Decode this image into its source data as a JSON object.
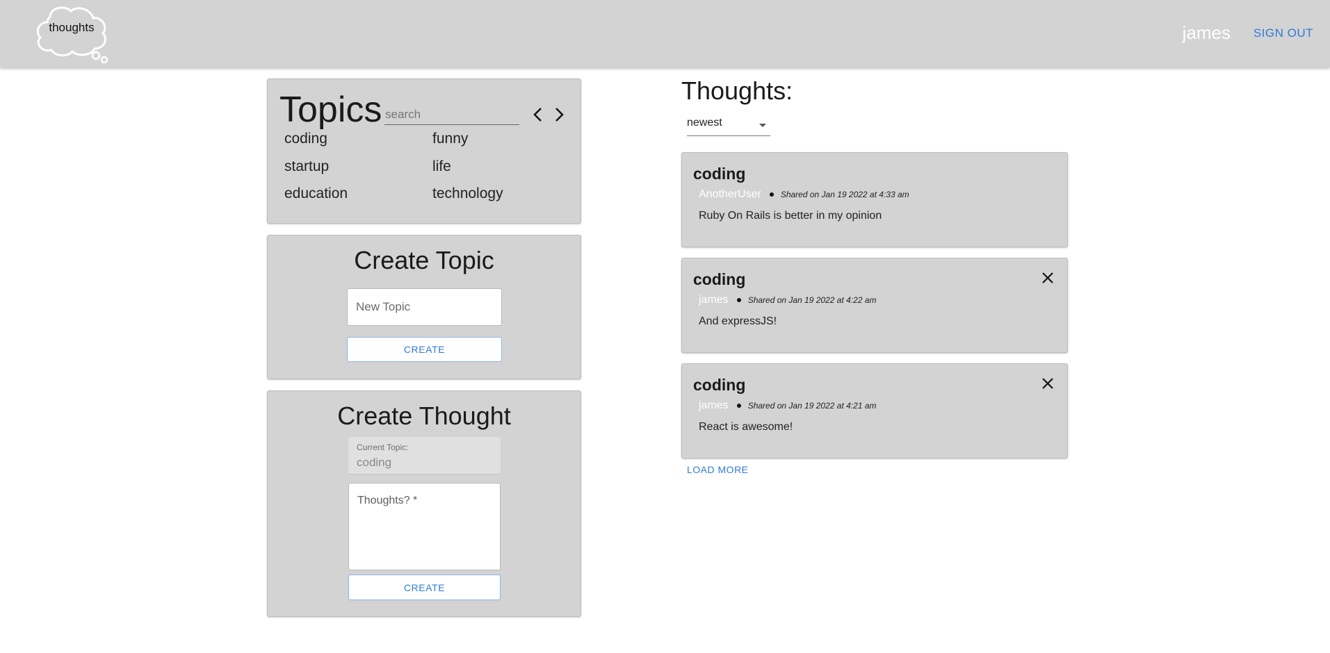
{
  "header": {
    "logo_text": "thoughts",
    "user_name": "james",
    "sign_out_label": "SIGN OUT",
    "accent_color": "#2f7bd6",
    "bar_color": "#d3d3d3"
  },
  "topics": {
    "title": "Topics",
    "search_placeholder": "search",
    "prev_icon": "chevron-left-icon",
    "next_icon": "chevron-right-icon",
    "items": [
      {
        "label": "coding"
      },
      {
        "label": "funny"
      },
      {
        "label": "startup"
      },
      {
        "label": "life"
      },
      {
        "label": "education"
      },
      {
        "label": "technology"
      }
    ]
  },
  "create_topic": {
    "title": "Create Topic",
    "placeholder": "New Topic",
    "button_label": "CREATE"
  },
  "create_thought": {
    "title": "Create Thought",
    "current_topic_label": "Current Topic:",
    "current_topic_value": "coding",
    "thought_placeholder": "Thoughts? *",
    "button_label": "CREATE"
  },
  "feed": {
    "title": "Thoughts:",
    "sort_value": "newest",
    "load_more_label": "LOAD MORE",
    "posts": [
      {
        "topic": "coding",
        "author": "AnotherUser",
        "date": "Shared on Jan 19 2022 at 4:33 am",
        "body": "Ruby On Rails is better in my opinion",
        "deletable": false
      },
      {
        "topic": "coding",
        "author": "james",
        "date": "Shared on Jan 19 2022 at 4:22 am",
        "body": "And expressJS!",
        "deletable": true
      },
      {
        "topic": "coding",
        "author": "james",
        "date": "Shared on Jan 19 2022 at 4:21 am",
        "body": "React is awesome!",
        "deletable": true
      }
    ]
  }
}
